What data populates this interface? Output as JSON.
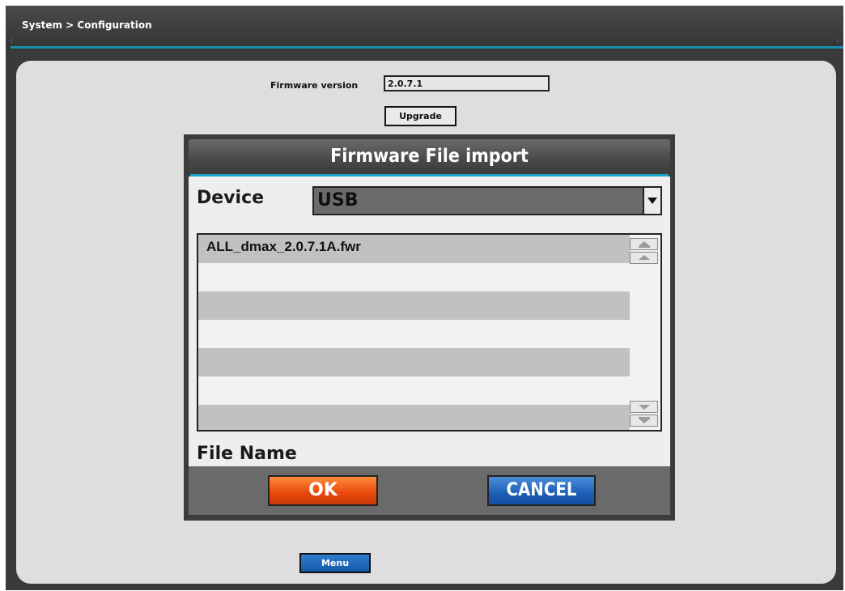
{
  "header": {
    "breadcrumb": "System > Configuration"
  },
  "firmware": {
    "label": "Firmware version",
    "value": "2.0.7.1",
    "upgrade_label": "Upgrade"
  },
  "dialog": {
    "title": "Firmware File import",
    "device_label": "Device",
    "device_value": "USB",
    "files": [
      "ALL_dmax_2.0.7.1A.fwr"
    ],
    "file_name_label": "File Name",
    "ok_label": "OK",
    "cancel_label": "CANCEL"
  },
  "footer": {
    "menu_label": "Menu"
  },
  "colors": {
    "accent": "#1a8fb0",
    "ok": "#e8480c",
    "cancel": "#1d5fb8",
    "menu": "#1558a8"
  }
}
